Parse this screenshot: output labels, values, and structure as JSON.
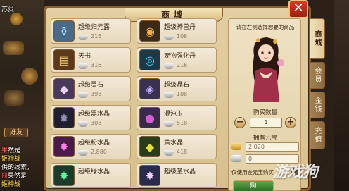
{
  "window": {
    "title": "商城",
    "close_glyph": "✕"
  },
  "items": [
    {
      "name": "超级归元露",
      "price": "216",
      "icon": "bottle-icon",
      "color": "#4a6a8a",
      "glyph": "⚱"
    },
    {
      "name": "超级神兽丹",
      "price": "108",
      "icon": "pill-icon",
      "color": "#3a2a1a",
      "glyph": "◉"
    },
    {
      "name": "天书",
      "price": "316",
      "icon": "book-icon",
      "color": "#5a3a1a",
      "glyph": "📜"
    },
    {
      "name": "宠物强化丹",
      "price": "216",
      "icon": "orb-icon",
      "color": "#1a3a4a",
      "glyph": "◎"
    },
    {
      "name": "超级灵石",
      "price": "398",
      "icon": "spirit-stone-icon",
      "color": "#4a3a5a",
      "glyph": "◆"
    },
    {
      "name": "超级晶石",
      "price": "108",
      "icon": "crystal-icon",
      "color": "#3a3050",
      "glyph": "◈"
    },
    {
      "name": "超级黑水晶",
      "price": "308",
      "icon": "black-crystal-icon",
      "color": "#202030",
      "glyph": "✸"
    },
    {
      "name": "混沌玉",
      "price": "518",
      "icon": "jade-icon",
      "color": "#3a2a4a",
      "glyph": "●"
    },
    {
      "name": "超级粉水晶",
      "price": "2,880",
      "icon": "pink-crystal-icon",
      "color": "#4a1a4a",
      "glyph": "✸"
    },
    {
      "name": "黄水晶",
      "price": "418",
      "icon": "yellow-crystal-icon",
      "color": "#2a3a1a",
      "glyph": "◆"
    },
    {
      "name": "超级绿水晶",
      "price": "",
      "icon": "green-crystal-icon",
      "color": "#1a3a2a",
      "glyph": "✸"
    },
    {
      "name": "超级圣水晶",
      "price": "",
      "icon": "holy-crystal-icon",
      "color": "#2a2a4a",
      "glyph": "✸"
    }
  ],
  "panel": {
    "hint": "请在左侧选择想要的商品",
    "qty_label": "购买数量",
    "qty_value": "1",
    "minus": "−",
    "plus": "+",
    "owned_label": "拥有元宝",
    "gold_value": "2,020",
    "silver_value": "0",
    "only_gold_label": "仅使用金元宝购买",
    "buy_label": "购"
  },
  "tabs": [
    {
      "label": "商城",
      "active": true
    },
    {
      "label": "会员",
      "active": false
    },
    {
      "label": "金钱",
      "active": false
    },
    {
      "label": "充值",
      "active": false
    }
  ],
  "left_chat": [
    {
      "tag": "",
      "text": "苏炎"
    },
    {
      "tag": "果",
      "text": "然是"
    },
    {
      "tag": "",
      "text": "姬神战"
    },
    {
      "tag": "",
      "text": "供的线索，"
    },
    {
      "tag": "丽",
      "text": "果然是"
    },
    {
      "tag": "",
      "text": "姬神战"
    },
    {
      "tag": "",
      "text": "\\ 前 "
    },
    {
      "tag": "",
      "text": "\\ 要下"
    }
  ],
  "left_badge": "好友",
  "watermark": "游戏狗",
  "colors": {
    "frame": "#8a5e2c",
    "parchment": "#e2cfa2",
    "close_red": "#c8301a",
    "buy_green": "#3f8a34"
  }
}
